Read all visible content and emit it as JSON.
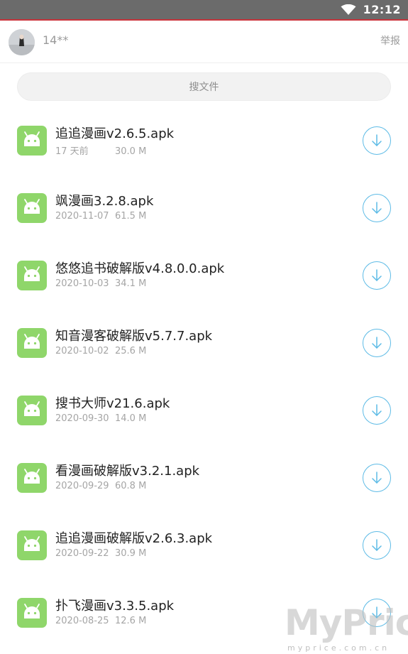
{
  "status_bar": {
    "time": "12:12",
    "wifi_icon": "wifi-icon",
    "accent_color": "#c8333b"
  },
  "header": {
    "username": "14**",
    "report_label": "举报"
  },
  "search": {
    "placeholder": "搜文件"
  },
  "files": [
    {
      "name": "追追漫画v2.6.5.apk",
      "date": "17 天前",
      "size": "30.0 M"
    },
    {
      "name": "飒漫画3.2.8.apk",
      "date": "2020-11-07",
      "size": "61.5 M"
    },
    {
      "name": "悠悠追书破解版v4.8.0.0.apk",
      "date": "2020-10-03",
      "size": "34.1 M"
    },
    {
      "name": "知音漫客破解版v5.7.7.apk",
      "date": "2020-10-02",
      "size": "25.6 M"
    },
    {
      "name": "搜书大师v21.6.apk",
      "date": "2020-09-30",
      "size": "14.0 M"
    },
    {
      "name": "看漫画破解版v3.2.1.apk",
      "date": "2020-09-29",
      "size": "60.8 M"
    },
    {
      "name": "追追漫画破解版v2.6.3.apk",
      "date": "2020-09-22",
      "size": "30.9 M"
    },
    {
      "name": "扑飞漫画v3.3.5.apk",
      "date": "2020-08-25",
      "size": "12.6 M"
    }
  ],
  "file_icon": "android-icon",
  "download_icon": "download-icon",
  "colors": {
    "android_green": "#8fd66a",
    "download_blue": "#5dbbe6"
  },
  "watermark": {
    "brand": "MyPrice",
    "url": "myprice.com.cn"
  }
}
